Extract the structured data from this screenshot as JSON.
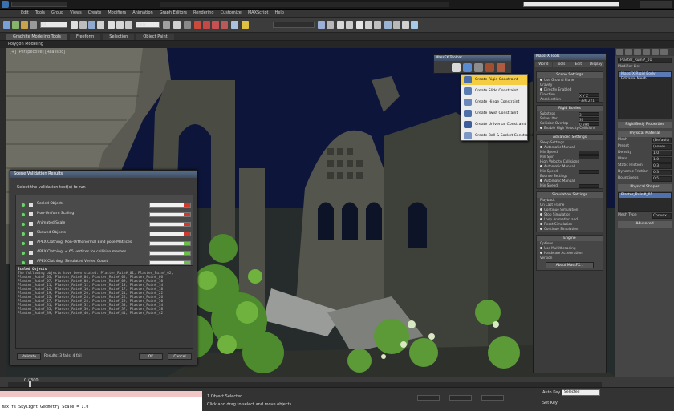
{
  "colors": {
    "accent_blue": "#3a6fb0",
    "highlight_yellow": "#f5cd43",
    "check_green": "#6fd26f",
    "bar_red": "#d03a2a",
    "bar_green": "#6cc04a"
  },
  "menubar": {
    "items": [
      "Edit",
      "Tools",
      "Group",
      "Views",
      "Create",
      "Modifiers",
      "Animation",
      "Graph Editors",
      "Rendering",
      "Customize",
      "MAXScript",
      "Help"
    ]
  },
  "toolbar": {
    "selection_filter": "All",
    "view_dropdown": "View"
  },
  "ribbon": {
    "tabs": [
      "Graphite Modeling Tools",
      "Freeform",
      "Selection",
      "Object Paint"
    ],
    "subtitle": "Polygon Modeling"
  },
  "viewport": {
    "label": "[+] [Perspective] [Realistic]"
  },
  "validator": {
    "title": "Scene Validation Results",
    "prompt": "Select the validation test(s) to run",
    "checks": [
      {
        "label": "Scaled Objects",
        "status": "red"
      },
      {
        "label": "Non-Uniform Scaling",
        "status": "red"
      },
      {
        "label": "Animated Scale",
        "status": "red"
      },
      {
        "label": "Skewed Objects",
        "status": "red"
      },
      {
        "label": "APEX Clothing: Non-Orthonormal Bind pose Matrices",
        "status": "green"
      },
      {
        "label": "APEX Clothing: < 65 vertices for collision meshes",
        "status": "green"
      },
      {
        "label": "APEX Clothing: Simulated Vertex Count",
        "status": "green"
      }
    ],
    "results_header": "Scaled Objects",
    "results_lines": [
      "The following objects have been scaled: Plaster_Ruin#_01, Plaster_Ruin#_02,",
      "Plaster_Ruin#_03, Plaster_Ruin#_04, Plaster_Ruin#_05, Plaster_Ruin#_06,",
      "Plaster_Ruin#_07, Plaster_Ruin#_08, Plaster_Ruin#_09, Plaster_Ruin#_10,",
      "Plaster_Ruin#_11, Plaster_Ruin#_12, Plaster_Ruin#_13, Plaster_Ruin#_14,",
      "Plaster_Ruin#_15, Plaster_Ruin#_16, Plaster_Ruin#_17, Plaster_Ruin#_18,",
      "Plaster_Ruin#_19, Plaster_Ruin#_20, Plaster_Ruin#_21, Plaster_Ruin#_22,",
      "Plaster_Ruin#_23, Plaster_Ruin#_24, Plaster_Ruin#_25, Plaster_Ruin#_26,",
      "Plaster_Ruin#_27, Plaster_Ruin#_28, Plaster_Ruin#_29, Plaster_Ruin#_30,",
      "Plaster_Ruin#_31, Plaster_Ruin#_32, Plaster_Ruin#_33, Plaster_Ruin#_34,",
      "Plaster_Ruin#_35, Plaster_Ruin#_36, Plaster_Ruin#_37, Plaster_Ruin#_38,",
      "Plaster_Ruin#_39, Plaster_Ruin#_40, Plaster_Ruin#_41, Plaster_Ruin#_42"
    ],
    "validate_label": "Validate",
    "results_summary": "Results: 3 fails, 4 fail",
    "ok_label": "OK",
    "cancel_label": "Cancel"
  },
  "constraint_bar": {
    "title": "MassFX Toolbar",
    "icons": [
      "world-icon",
      "rigid-body-icon",
      "constraint-icon",
      "cloth-icon",
      "sim-icon"
    ]
  },
  "constraint_menu": {
    "items": [
      {
        "label": "Create Rigid Constraint",
        "highlighted": true
      },
      {
        "label": "Create Slide Constraint",
        "highlighted": false
      },
      {
        "label": "Create Hinge Constraint",
        "highlighted": false
      },
      {
        "label": "Create Twist Constraint",
        "highlighted": false
      },
      {
        "label": "Create Universal Constraint",
        "highlighted": false
      },
      {
        "label": "Create Ball & Socket Constraint",
        "highlighted": false
      }
    ]
  },
  "massfx": {
    "title": "MassFX Tools",
    "tabs": [
      "World",
      "Tools",
      "Edit",
      "Display"
    ],
    "scene_settings": {
      "title": "Scene Settings",
      "lines": [
        "Use Ground Plane",
        "Gravity",
        "Directly Enabled",
        "Direction",
        "Acceleration"
      ],
      "values": [
        "",
        "",
        "",
        "X  Y  Z",
        "-386.221"
      ]
    },
    "rigid_bodies": {
      "title": "Rigid Bodies",
      "lines": [
        "Substeps",
        "Solver Iter.",
        "Collision Overlap",
        "Enable High Velocity Collisions"
      ],
      "values": [
        "3",
        "30",
        "0.394",
        ""
      ]
    },
    "advanced": {
      "title": "Advanced Settings",
      "lines": [
        "Sleep Settings",
        "Automatic  Manual",
        "Min Speed",
        "Min Spin",
        "High Velocity Collisions",
        "Automatic  Manual",
        "Min Speed",
        "Bounce Settings",
        "Automatic  Manual",
        "Min Speed"
      ]
    },
    "simulation": {
      "title": "Simulation Settings",
      "lines": [
        "Playback",
        "On Last Frame",
        "Continue Simulation",
        "Stop Simulation",
        "Loop Animation and...",
        "Reset Simulation",
        "Continue Simulation"
      ]
    },
    "engine": {
      "title": "Engine",
      "lines": [
        "Options",
        "Use Multithreading",
        "Hardware Acceleration",
        "Version"
      ],
      "about_label": "About MassFX..."
    }
  },
  "right_panel": {
    "object_name": "Plaster_Ruin#_01",
    "modifier_list": "Modifier List",
    "stack": [
      {
        "label": "MassFX Rigid Body",
        "selected": true
      },
      {
        "label": "Editable Mesh",
        "selected": false
      }
    ],
    "rollout1": "Rigid Body Properties",
    "rollout2": "Physical Material",
    "rows": [
      {
        "label": "Mesh",
        "value": "(Default)"
      },
      {
        "label": "Preset",
        "value": "(none)"
      },
      {
        "label": "Density",
        "value": "1.0"
      },
      {
        "label": "Mass",
        "value": "1.0"
      },
      {
        "label": "Static Friction",
        "value": "0.3"
      },
      {
        "label": "Dynamic Friction",
        "value": "0.3"
      },
      {
        "label": "Bounciness",
        "value": "0.5"
      }
    ],
    "rollout3": "Physical Shapes",
    "shapes_list": [
      "Plaster_Ruin#_01"
    ],
    "mesh_type_label": "Mesh Type",
    "mesh_type_value": "Convex",
    "rollout4": "Advanced"
  },
  "timeline": {
    "counter": "0 / 300"
  },
  "status": {
    "maxscript": "max fs Skylight Geometry Scale = 1.0",
    "selection": "1 Object Selected",
    "prompt": "Click and drag to select and move objects",
    "auto_key": "Auto Key",
    "auto_key_value": "Selected",
    "set_key": "Set Key"
  }
}
